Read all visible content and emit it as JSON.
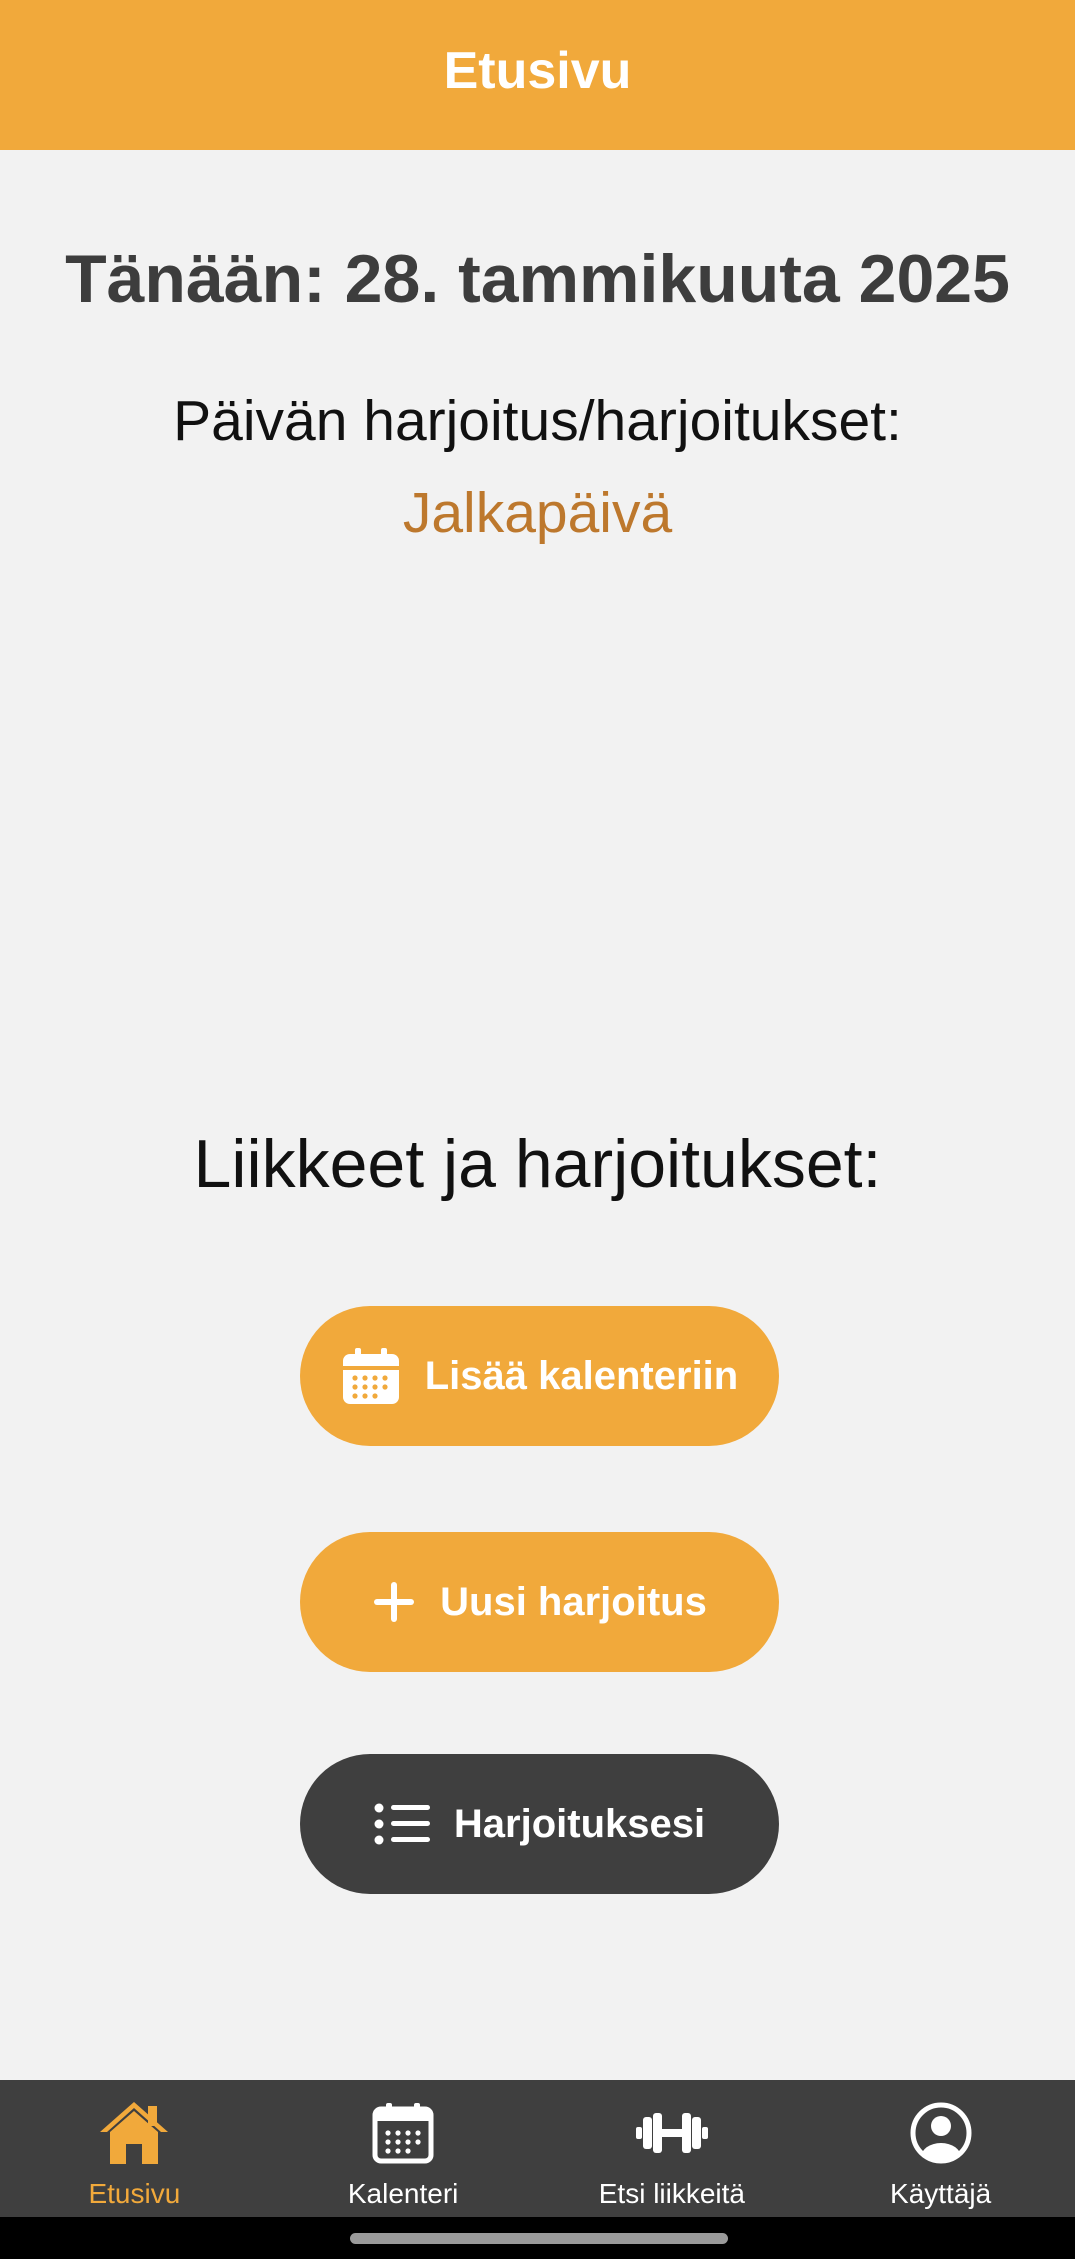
{
  "header": {
    "title": "Etusivu"
  },
  "today": {
    "text": "Tänään: 28. tammikuuta 2025"
  },
  "day_workout": {
    "label": "Päivän harjoitus/harjoitukset:",
    "name": "Jalkapäivä"
  },
  "section": {
    "title": "Liikkeet ja harjoitukset:"
  },
  "buttons": {
    "add_calendar": {
      "label": "Lisää kalenteriin",
      "icon": "calendar-icon"
    },
    "new_workout": {
      "label": "Uusi harjoitus",
      "icon": "plus-icon"
    },
    "your_workouts": {
      "label": "Harjoituksesi",
      "icon": "list-icon"
    }
  },
  "tabs": [
    {
      "label": "Etusivu",
      "icon": "home-icon",
      "active": true
    },
    {
      "label": "Kalenteri",
      "icon": "calendar-icon",
      "active": false
    },
    {
      "label": "Etsi liikkeitä",
      "icon": "dumbbell-icon",
      "active": false
    },
    {
      "label": "Käyttäjä",
      "icon": "user-icon",
      "active": false
    }
  ],
  "colors": {
    "accent": "#f1a93b",
    "dark": "#3f3f3f",
    "workout_text": "#bd782d",
    "background": "#f2f2f2"
  }
}
